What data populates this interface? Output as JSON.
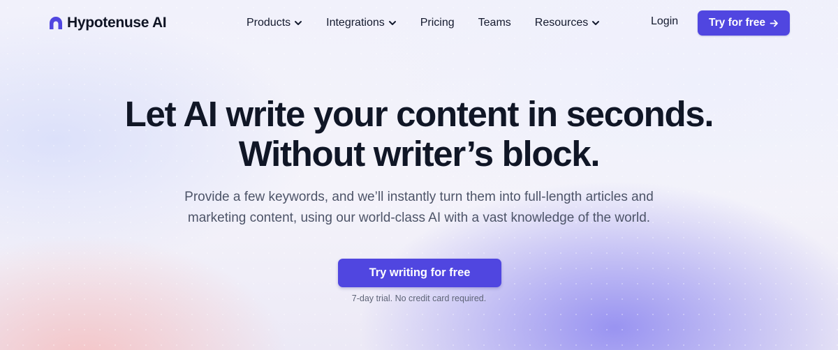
{
  "brand": {
    "name": "Hypotenuse AI",
    "logo_icon": "arch-logo-icon",
    "accent": "#5046E0"
  },
  "nav": {
    "items": [
      {
        "label": "Products",
        "has_dropdown": true
      },
      {
        "label": "Integrations",
        "has_dropdown": true
      },
      {
        "label": "Pricing",
        "has_dropdown": false
      },
      {
        "label": "Teams",
        "has_dropdown": false
      },
      {
        "label": "Resources",
        "has_dropdown": true
      }
    ],
    "login_label": "Login",
    "cta_label": "Try for free"
  },
  "hero": {
    "headline_line1": "Let AI write your content in seconds.",
    "headline_line2": "Without writer’s block.",
    "sub_line1": "Provide a few keywords, and we’ll instantly turn them into full-length articles and",
    "sub_line2": "marketing content, using our world-class AI with a vast knowledge of the world.",
    "cta_label": "Try writing for free",
    "note": "7-day trial. No credit card required."
  }
}
